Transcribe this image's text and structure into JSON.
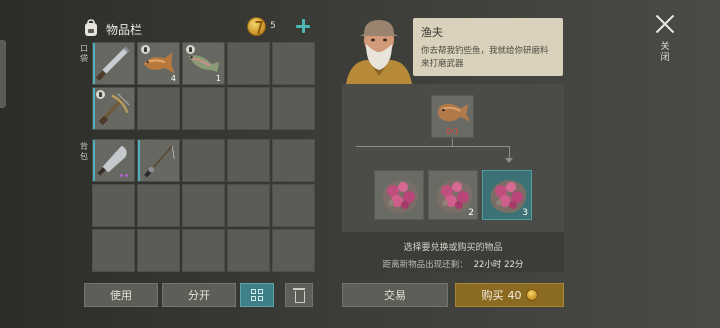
{
  "inventory": {
    "title": "物品栏",
    "coins": "5",
    "pockets_label": "口袋",
    "backpack_label": "背包",
    "pocket_slots": [
      {
        "item": "machete",
        "qty": "",
        "badge": false
      },
      {
        "item": "fish",
        "qty": "4",
        "badge": true
      },
      {
        "item": "trout",
        "qty": "1",
        "badge": true
      },
      {
        "item": "empty"
      },
      {
        "item": "empty"
      },
      {
        "item": "crossbow",
        "qty": "",
        "badge": true
      },
      {
        "item": "empty"
      },
      {
        "item": "empty"
      },
      {
        "item": "empty"
      },
      {
        "item": "empty"
      }
    ],
    "backpack_slots": [
      {
        "item": "cleaver",
        "dots": 2
      },
      {
        "item": "fishing-rod"
      },
      {
        "item": "empty"
      },
      {
        "item": "empty"
      },
      {
        "item": "empty"
      },
      {
        "item": "empty"
      },
      {
        "item": "empty"
      },
      {
        "item": "empty"
      },
      {
        "item": "empty"
      },
      {
        "item": "empty"
      },
      {
        "item": "empty"
      },
      {
        "item": "empty"
      },
      {
        "item": "empty"
      },
      {
        "item": "empty"
      },
      {
        "item": "empty"
      }
    ]
  },
  "buttons": {
    "use": "使用",
    "split": "分开",
    "trade": "交易",
    "buy": "购买",
    "buy_price": "40"
  },
  "trader": {
    "name": "渔夫",
    "dialog": "你去帮我钓些鱼，我就给你研磨料来打磨武器",
    "required_count": "0/1",
    "rewards": [
      {
        "item": "grinding-stone",
        "qty": "",
        "selected": false
      },
      {
        "item": "grinding-stone",
        "qty": "2",
        "selected": false
      },
      {
        "item": "grinding-stone",
        "qty": "3",
        "selected": true
      }
    ],
    "hint": "选择要兑换或购买的物品",
    "refresh_label": "距离新物品出现还剩：",
    "refresh_time": "22小时 22分"
  },
  "close_label": "关闭",
  "colors": {
    "accent": "#4db6b3",
    "buy_button": "#8b6a22",
    "selected_slot": "#3c7276",
    "required_count": "#d94a3c"
  }
}
